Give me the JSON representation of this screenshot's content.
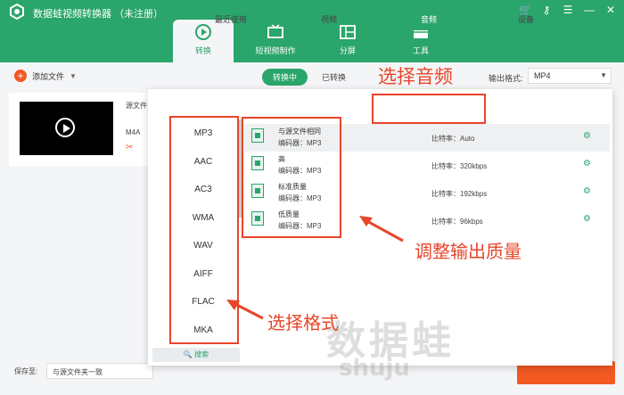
{
  "app": {
    "title": "数据蛙视频转换器 （未注册）",
    "brand_color": "#2aa56b",
    "accent_color": "#f25a22",
    "window_controls": [
      "cart-icon",
      "key-icon",
      "menu-icon",
      "minimize-icon",
      "close-icon"
    ]
  },
  "main_tabs": [
    {
      "label": "转换",
      "icon": "convert-icon",
      "active": true
    },
    {
      "label": "短视频制作",
      "icon": "video-maker-icon",
      "active": false
    },
    {
      "label": "分屏",
      "icon": "split-screen-icon",
      "active": false
    },
    {
      "label": "工具",
      "icon": "toolbox-icon",
      "active": false
    }
  ],
  "toolbar": {
    "add_file": "添加文件",
    "status_tabs": [
      "转换中",
      "已转换"
    ],
    "output_format_label": "输出格式:",
    "output_format_value": "MP4"
  },
  "file": {
    "source_label": "源文件",
    "format": "M4A"
  },
  "footer": {
    "save_to_label": "保存至:",
    "save_to_value": "与源文件夹一致"
  },
  "dropdown": {
    "tabs": [
      "最近使用",
      "视频",
      "音频",
      "设备"
    ],
    "active_tab": "音频",
    "formats": [
      "MP3",
      "AAC",
      "AC3",
      "WMA",
      "WAV",
      "AIFF",
      "FLAC",
      "MKA"
    ],
    "search_label": "搜索",
    "qualities": [
      {
        "name": "与源文件相同",
        "codec": "编码器：MP3",
        "bitrate": "比特率：Auto"
      },
      {
        "name": "高",
        "codec": "编码器：MP3",
        "bitrate": "比特率：320kbps"
      },
      {
        "name": "标准质量",
        "codec": "编码器：MP3",
        "bitrate": "比特率：192kbps"
      },
      {
        "name": "低质量",
        "codec": "编码器：MP3",
        "bitrate": "比特率：96kbps"
      }
    ]
  },
  "annotations": {
    "select_audio": "选择音频",
    "adjust_quality": "调整输出质量",
    "select_format": "选择格式",
    "color": "#e8452a"
  },
  "watermark": {
    "text": "数据蛙",
    "sub": "shuju"
  }
}
